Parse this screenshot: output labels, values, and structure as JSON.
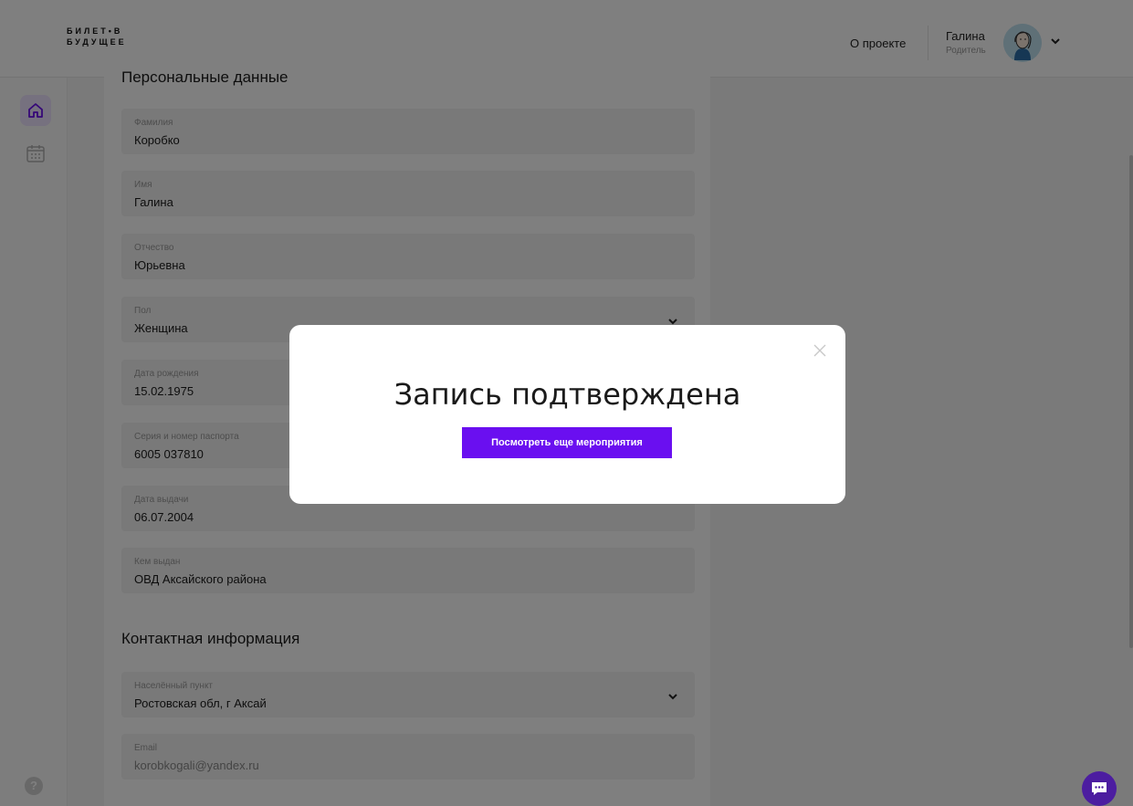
{
  "header": {
    "logo_line1": "БИЛЕТ•В",
    "logo_line2": "БУДУЩЕЕ",
    "about_link": "О проекте",
    "user_name": "Галина",
    "user_role": "Родитель",
    "avatar_icon": "avatar-woman-illustration",
    "chevron_icon": "chevron-down-icon"
  },
  "sidebar": {
    "items": [
      {
        "icon": "home-icon",
        "active": true
      },
      {
        "icon": "calendar-icon",
        "active": false
      }
    ],
    "help_label": "?"
  },
  "personal_section": {
    "title": "Персональные данные",
    "fields": [
      {
        "label": "Фамилия",
        "value": "Коробко"
      },
      {
        "label": "Имя",
        "value": "Галина"
      },
      {
        "label": "Отчество",
        "value": "Юрьевна"
      },
      {
        "label": "Пол",
        "value": "Женщина"
      },
      {
        "label": "Дата рождения",
        "value": "15.02.1975"
      },
      {
        "label": "Серия и номер паспорта",
        "value": "6005 037810"
      },
      {
        "label": "Дата выдачи",
        "value": "06.07.2004"
      },
      {
        "label": "Кем выдан",
        "value": "ОВД Аксайского района"
      }
    ]
  },
  "contact_section": {
    "title": "Контактная информация",
    "fields": [
      {
        "label": "Населённый пункт",
        "value": "Ростовская обл, г Аксай"
      },
      {
        "label": "Email",
        "value": "korobkogali@yandex.ru"
      }
    ]
  },
  "modal": {
    "title": "Запись подтверждена",
    "button_label": "Посмотреть еще мероприятия",
    "close_icon": "close-icon"
  },
  "colors": {
    "accent": "#6a0ff0",
    "chat_button": "#4c1da0",
    "overlay": "rgba(0,0,0,0.5)"
  }
}
